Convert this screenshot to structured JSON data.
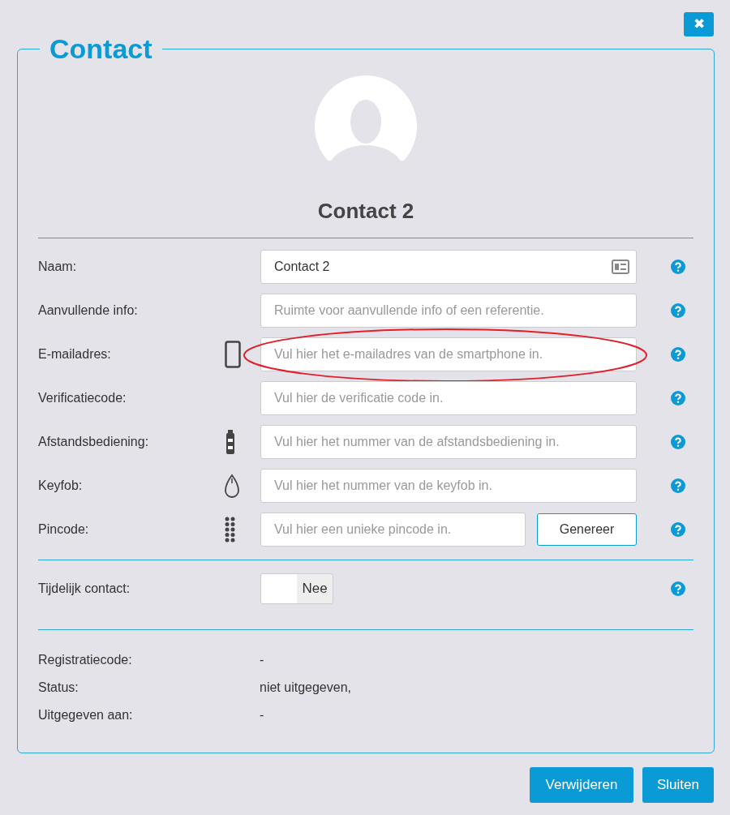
{
  "close_button": {
    "label": "✖"
  },
  "panel": {
    "legend": "Contact",
    "contact_name": "Contact 2"
  },
  "fields": [
    {
      "label": "Naam:",
      "kind": "name",
      "value": "Contact 2",
      "highlighted": false
    },
    {
      "label": "Aanvullende info:",
      "kind": "plain",
      "placeholder": "Ruimte voor aanvullende info of een referentie.",
      "highlighted": false
    },
    {
      "label": "E-mailadres:",
      "kind": "smartphone",
      "placeholder": "Vul hier het e-mailadres van de smartphone in.",
      "highlighted": true
    },
    {
      "label": "Verificatiecode:",
      "kind": "plain",
      "placeholder": "Vul hier de verificatie code in.",
      "highlighted": false
    },
    {
      "label": "Afstandsbediening:",
      "kind": "remote",
      "placeholder": "Vul hier het nummer van de afstandsbediening in.",
      "highlighted": false
    },
    {
      "label": "Keyfob:",
      "kind": "keyfob",
      "placeholder": "Vul hier het nummer van de keyfob in.",
      "highlighted": false
    },
    {
      "label": "Pincode:",
      "kind": "pincode",
      "placeholder": "Vul hier een unieke pincode in.",
      "button": "Genereer",
      "highlighted": false
    }
  ],
  "temporary": {
    "label": "Tijdelijk contact:",
    "on": false,
    "state_text": "Nee"
  },
  "info": [
    {
      "label": "Registratiecode:",
      "value": "-"
    },
    {
      "label": "Status:",
      "value": "niet uitgegeven,"
    },
    {
      "label": "Uitgegeven aan:",
      "value": "-"
    }
  ],
  "buttons": [
    "Verwijderen",
    "Sluiten"
  ]
}
